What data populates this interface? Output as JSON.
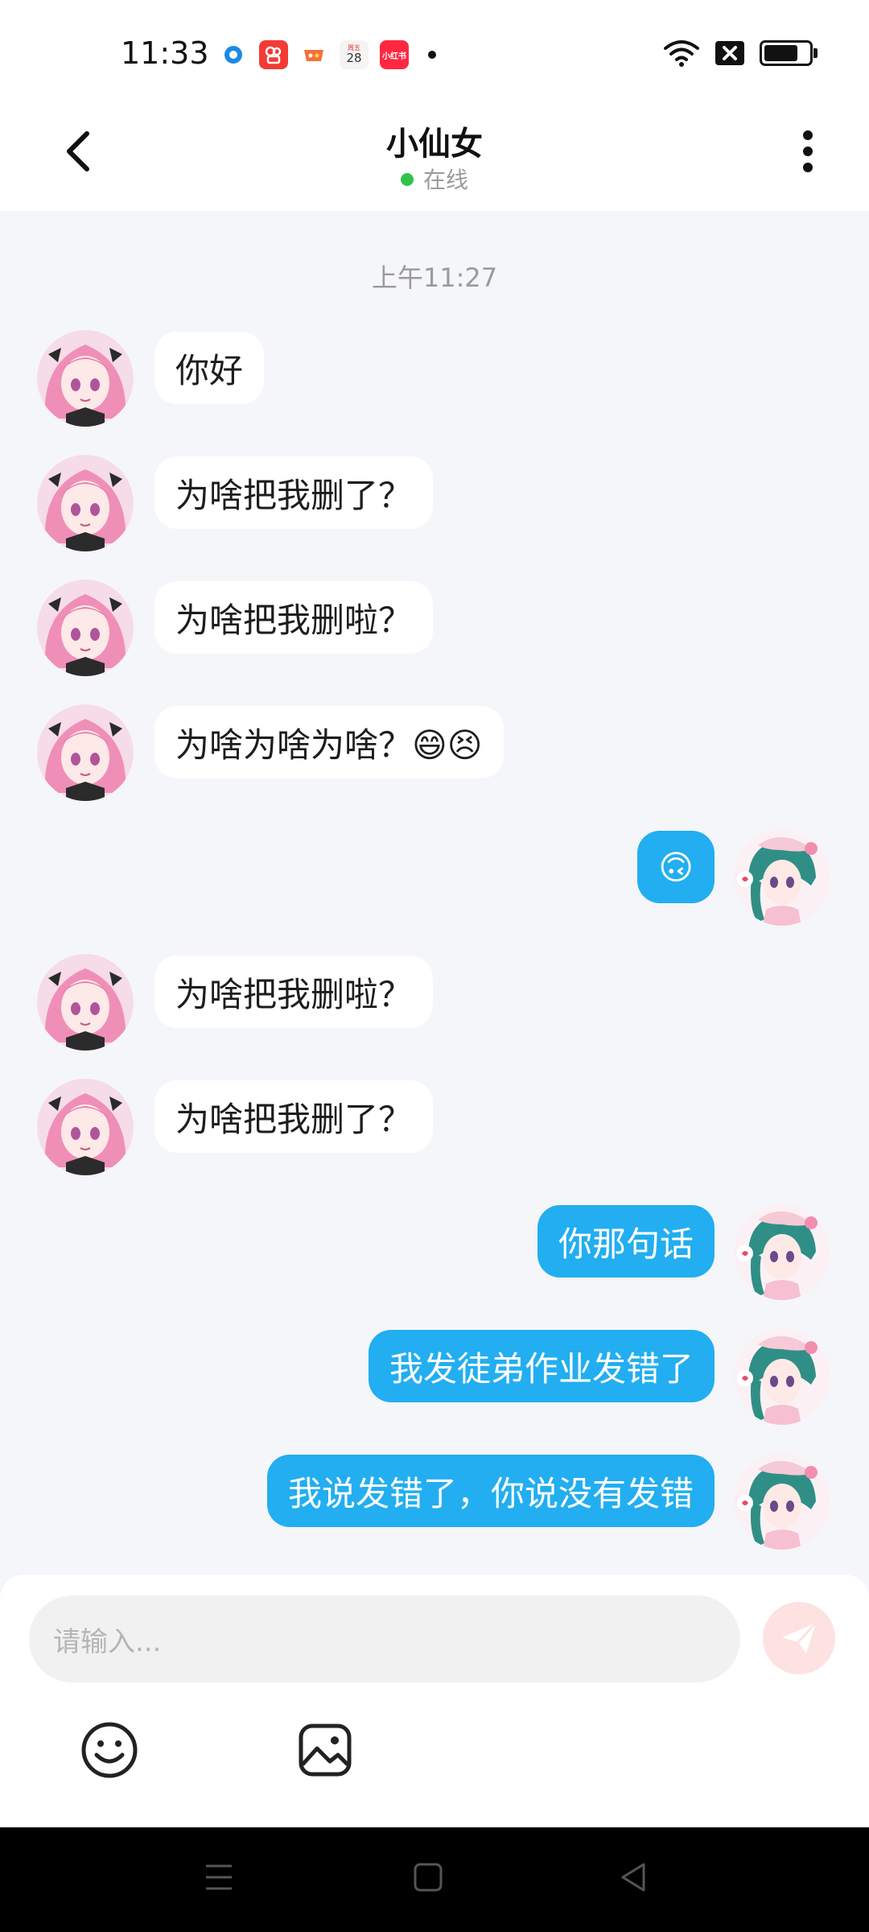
{
  "status_bar": {
    "time": "11:33",
    "app_icons": [
      "blue-ring-app-icon",
      "kuaishou-app-icon",
      "game-app-icon",
      "calendar-app-icon",
      "xiaohongshu-app-icon"
    ],
    "calendar_day": "28",
    "xhs_label": "小红书",
    "battery_level": 0.75
  },
  "header": {
    "title": "小仙女",
    "presence": "在线"
  },
  "chat": {
    "timestamp": "上午11:27",
    "messages": [
      {
        "side": "left",
        "text": "你好"
      },
      {
        "side": "left",
        "text": "为啥把我删了？"
      },
      {
        "side": "left",
        "text": "为啥把我删啦？"
      },
      {
        "side": "left",
        "text": "为啥为啥为啥？😄😣"
      },
      {
        "side": "right",
        "text": "🙃"
      },
      {
        "side": "left",
        "text": "为啥把我删啦？"
      },
      {
        "side": "left",
        "text": "为啥把我删了？"
      },
      {
        "side": "right",
        "text": "你那句话"
      },
      {
        "side": "right",
        "text": "我发徒弟作业发错了"
      },
      {
        "side": "right",
        "text": "我说发错了，你说没有发错"
      }
    ]
  },
  "composer": {
    "placeholder": "请输入..."
  },
  "colors": {
    "outgoing_bubble": "#22aef0",
    "incoming_bubble": "#ffffff",
    "online_dot": "#2ec44a",
    "send_button": "#fde2e1"
  }
}
